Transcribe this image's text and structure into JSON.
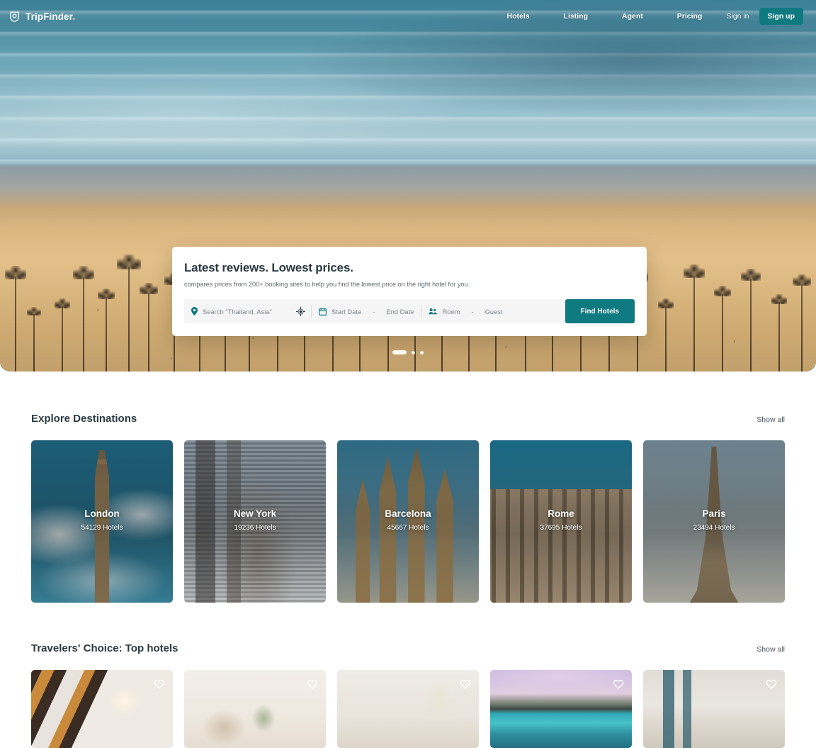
{
  "brand": {
    "name": "TripFinder.",
    "logo_icon": "shield-badge-icon"
  },
  "nav": {
    "links": [
      {
        "label": "Hotels"
      },
      {
        "label": "Listing"
      },
      {
        "label": "Agent"
      },
      {
        "label": "Pricing"
      }
    ],
    "sign_in": "Sign in",
    "sign_up": "Sign up"
  },
  "hero": {
    "card": {
      "title": "Latest reviews. Lowest prices.",
      "subtitle": "compares prices from 200+ booking sites to help you find the lowest price on the right hotel for you.",
      "search": {
        "location_icon": "map-pin-icon",
        "location_placeholder": "Search \"Thailand, Asia\"",
        "locate_icon": "crosshair-gps-icon",
        "calendar_icon": "calendar-icon",
        "start_date_placeholder": "Start Date",
        "date_separator": "-",
        "end_date_placeholder": "End Date",
        "guest_icon": "people-icon",
        "room_placeholder": "Room",
        "room_separator": "-",
        "guest_placeholder": "Guest",
        "submit_label": "Find Hotels"
      }
    },
    "carousel": {
      "total": 3,
      "active_index": 0
    }
  },
  "explore": {
    "title": "Explore Destinations",
    "show_all": "Show all",
    "cards": [
      {
        "name": "London",
        "count": "54129 Hotels",
        "art": "art-london"
      },
      {
        "name": "New York",
        "count": "19236 Hotels",
        "art": "art-newyork"
      },
      {
        "name": "Barcelona",
        "count": "45667 Hotels",
        "art": "art-barcelona"
      },
      {
        "name": "Rome",
        "count": "37695 Hotels",
        "art": "art-rome"
      },
      {
        "name": "Paris",
        "count": "23494 Hotels",
        "art": "art-paris"
      }
    ]
  },
  "top_hotels": {
    "title": "Travelers' Choice: Top hotels",
    "show_all": "Show all",
    "cards": [
      {
        "art": "h1img",
        "fav_icon": "heart-outline-icon"
      },
      {
        "art": "h2img",
        "fav_icon": "heart-outline-icon"
      },
      {
        "art": "h3img",
        "fav_icon": "heart-outline-icon"
      },
      {
        "art": "h4img",
        "fav_icon": "heart-outline-icon"
      },
      {
        "art": "h5img",
        "fav_icon": "heart-outline-icon"
      }
    ]
  },
  "colors": {
    "accent_teal": "#0f7a80",
    "text_dark": "#2b3a42",
    "text_muted": "#5c6b72",
    "card_bg": "#ffffff",
    "search_field_bg": "#f5f5f5"
  }
}
